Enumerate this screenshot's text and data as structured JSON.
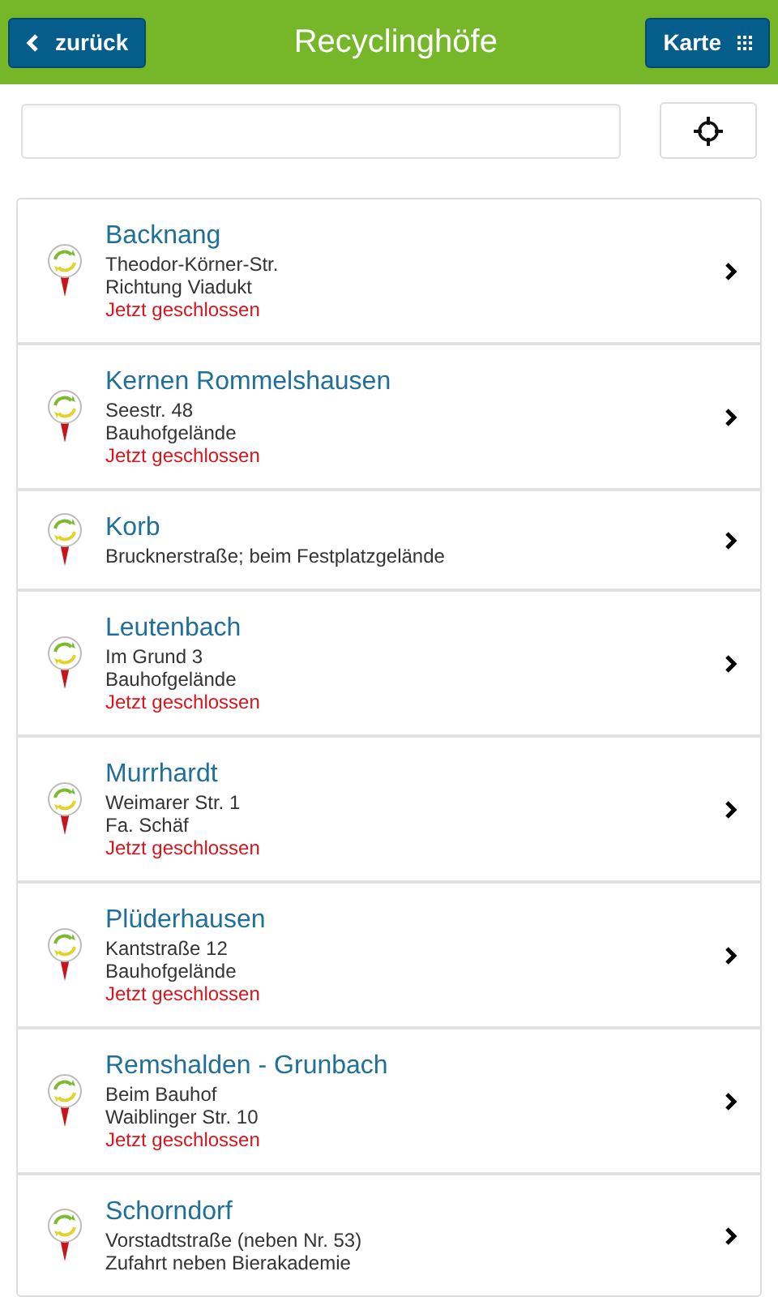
{
  "header": {
    "back_button": "zurück",
    "title": "Recyclinghöfe",
    "map_button": "Karte"
  },
  "sites": [
    {
      "name": "Backnang",
      "lines": [
        "Theodor-Körner-Str.",
        "Richtung Viadukt"
      ],
      "status": "Jetzt geschlossen"
    },
    {
      "name": "Kernen Rommelshausen",
      "lines": [
        "Seestr. 48",
        "Bauhofgelände"
      ],
      "status": "Jetzt geschlossen"
    },
    {
      "name": "Korb",
      "lines": [
        "Brucknerstraße; beim Festplatzgelände"
      ]
    },
    {
      "name": "Leutenbach",
      "lines": [
        "Im Grund 3",
        "Bauhofgelände"
      ],
      "status": "Jetzt geschlossen"
    },
    {
      "name": "Murrhardt",
      "lines": [
        "Weimarer Str. 1",
        "Fa. Schäf"
      ],
      "status": "Jetzt geschlossen"
    },
    {
      "name": "Plüderhausen",
      "lines": [
        "Kantstraße 12",
        "Bauhofgelände"
      ],
      "status": "Jetzt geschlossen"
    },
    {
      "name": "Remshalden - Grunbach",
      "lines": [
        "Beim Bauhof",
        "Waiblinger Str. 10"
      ],
      "status": "Jetzt geschlossen"
    },
    {
      "name": "Schorndorf",
      "lines": [
        "Vorstadtstraße (neben Nr. 53)",
        "Zufahrt neben Bierakademie"
      ]
    }
  ]
}
